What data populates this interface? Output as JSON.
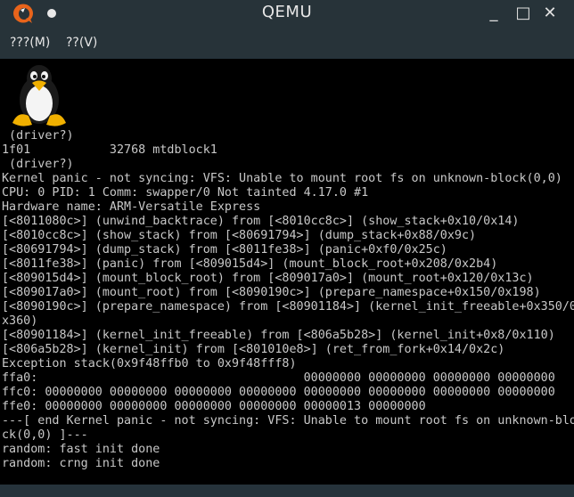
{
  "window": {
    "title": "QEMU",
    "app_icon": "qemu-logo-icon",
    "buttons": {
      "minimize": "_",
      "maximize": "□",
      "close": "✕"
    }
  },
  "menubar": {
    "items": [
      {
        "label": "???(M)"
      },
      {
        "label": "??(V)"
      }
    ]
  },
  "console": {
    "logo": "tux-penguin-icon",
    "lines": [
      " (driver?)",
      "1f01           32768 mtdblock1",
      " (driver?)",
      "Kernel panic - not syncing: VFS: Unable to mount root fs on unknown-block(0,0)",
      "CPU: 0 PID: 1 Comm: swapper/0 Not tainted 4.17.0 #1",
      "Hardware name: ARM-Versatile Express",
      "[<8011080c>] (unwind_backtrace) from [<8010cc8c>] (show_stack+0x10/0x14)",
      "[<8010cc8c>] (show_stack) from [<80691794>] (dump_stack+0x88/0x9c)",
      "[<80691794>] (dump_stack) from [<8011fe38>] (panic+0xf0/0x25c)",
      "[<8011fe38>] (panic) from [<809015d4>] (mount_block_root+0x208/0x2b4)",
      "[<809015d4>] (mount_block_root) from [<809017a0>] (mount_root+0x120/0x13c)",
      "[<809017a0>] (mount_root) from [<8090190c>] (prepare_namespace+0x150/0x198)",
      "[<8090190c>] (prepare_namespace) from [<80901184>] (kernel_init_freeable+0x350/0",
      "x360)",
      "[<80901184>] (kernel_init_freeable) from [<806a5b28>] (kernel_init+0x8/0x110)",
      "[<806a5b28>] (kernel_init) from [<801010e8>] (ret_from_fork+0x14/0x2c)",
      "Exception stack(0x9f48ffb0 to 0x9f48fff8)",
      "ffa0:                                     00000000 00000000 00000000 00000000",
      "ffc0: 00000000 00000000 00000000 00000000 00000000 00000000 00000000 00000000",
      "ffe0: 00000000 00000000 00000000 00000000 00000013 00000000",
      "---[ end Kernel panic - not syncing: VFS: Unable to mount root fs on unknown-blo",
      "ck(0,0) ]---",
      "random: fast init done",
      "random: crng init done"
    ]
  }
}
